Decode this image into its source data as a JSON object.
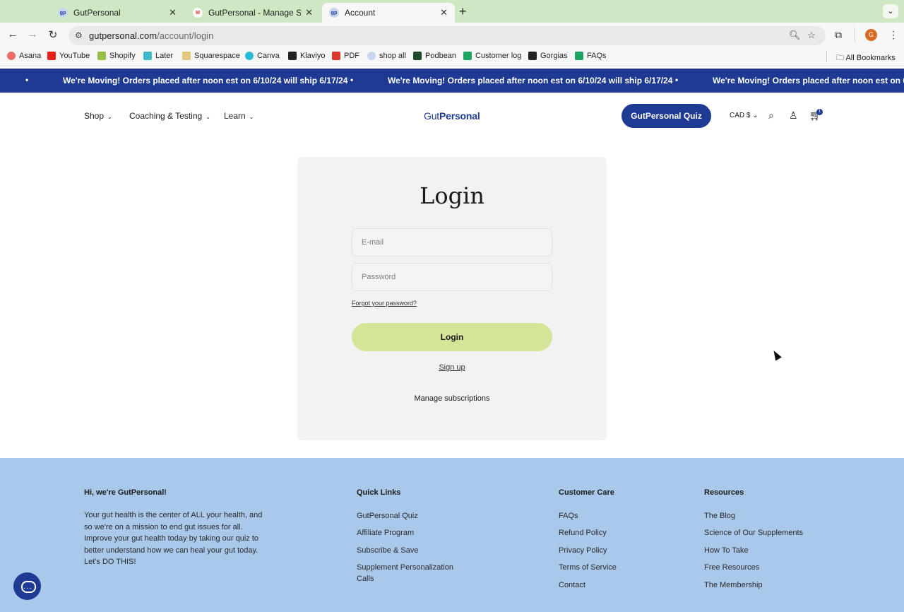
{
  "browser": {
    "tabs": [
      {
        "title": "GutPersonal",
        "favicon": "gutpersonal-icon"
      },
      {
        "title": "GutPersonal - Manage Subscri",
        "favicon": "gmail-icon"
      },
      {
        "title": "Account",
        "favicon": "gutpersonal-icon"
      }
    ],
    "new_tab": "+",
    "url_host": "gutpersonal.com",
    "url_path": "/account/login",
    "profile_initial": "G",
    "bookmarks": [
      "Asana",
      "YouTube",
      "Shopify",
      "Later",
      "Squarespace",
      "Canva",
      "Klaviyo",
      "PDF",
      "shop all",
      "Podbean",
      "Customer log",
      "Gorgias",
      "FAQs"
    ],
    "all_bookmarks": "All Bookmarks"
  },
  "announcement": {
    "message": "We're Moving! Orders placed after noon est on 6/10/24 will ship 6/17/24",
    "color": "#1f3a93"
  },
  "header": {
    "nav": [
      "Shop",
      "Coaching & Testing",
      "Learn"
    ],
    "logo_prefix": "Gut",
    "logo_suffix": "Personal",
    "quiz_button": "GutPersonal Quiz",
    "currency": "CAD $",
    "cart_count": "1"
  },
  "login": {
    "title": "Login",
    "email_placeholder": "E-mail",
    "password_placeholder": "Password",
    "forgot": "Forgot your password?",
    "submit": "Login",
    "signup": "Sign up",
    "manage": "Manage subscriptions",
    "button_color": "#d4e59a"
  },
  "footer": {
    "about_heading": "Hi, we're GutPersonal!",
    "about_text": "Your gut health is the center of ALL your health, and so we're on a mission to end gut issues for all. Improve your gut health today by taking our quiz to better understand how we can heal your gut today. Let's DO THIS!",
    "quick_links": {
      "heading": "Quick Links",
      "items": [
        "GutPersonal Quiz",
        "Affiliate Program",
        "Subscribe & Save",
        "Supplement Personalization Calls"
      ]
    },
    "customer_care": {
      "heading": "Customer Care",
      "items": [
        "FAQs",
        "Refund Policy",
        "Privacy Policy",
        "Terms of Service",
        "Contact"
      ]
    },
    "resources": {
      "heading": "Resources",
      "items": [
        "The Blog",
        "Science of Our Supplements",
        "How To Take",
        "Free Resources",
        "The Membership"
      ]
    },
    "background": "#a9c8ea"
  }
}
